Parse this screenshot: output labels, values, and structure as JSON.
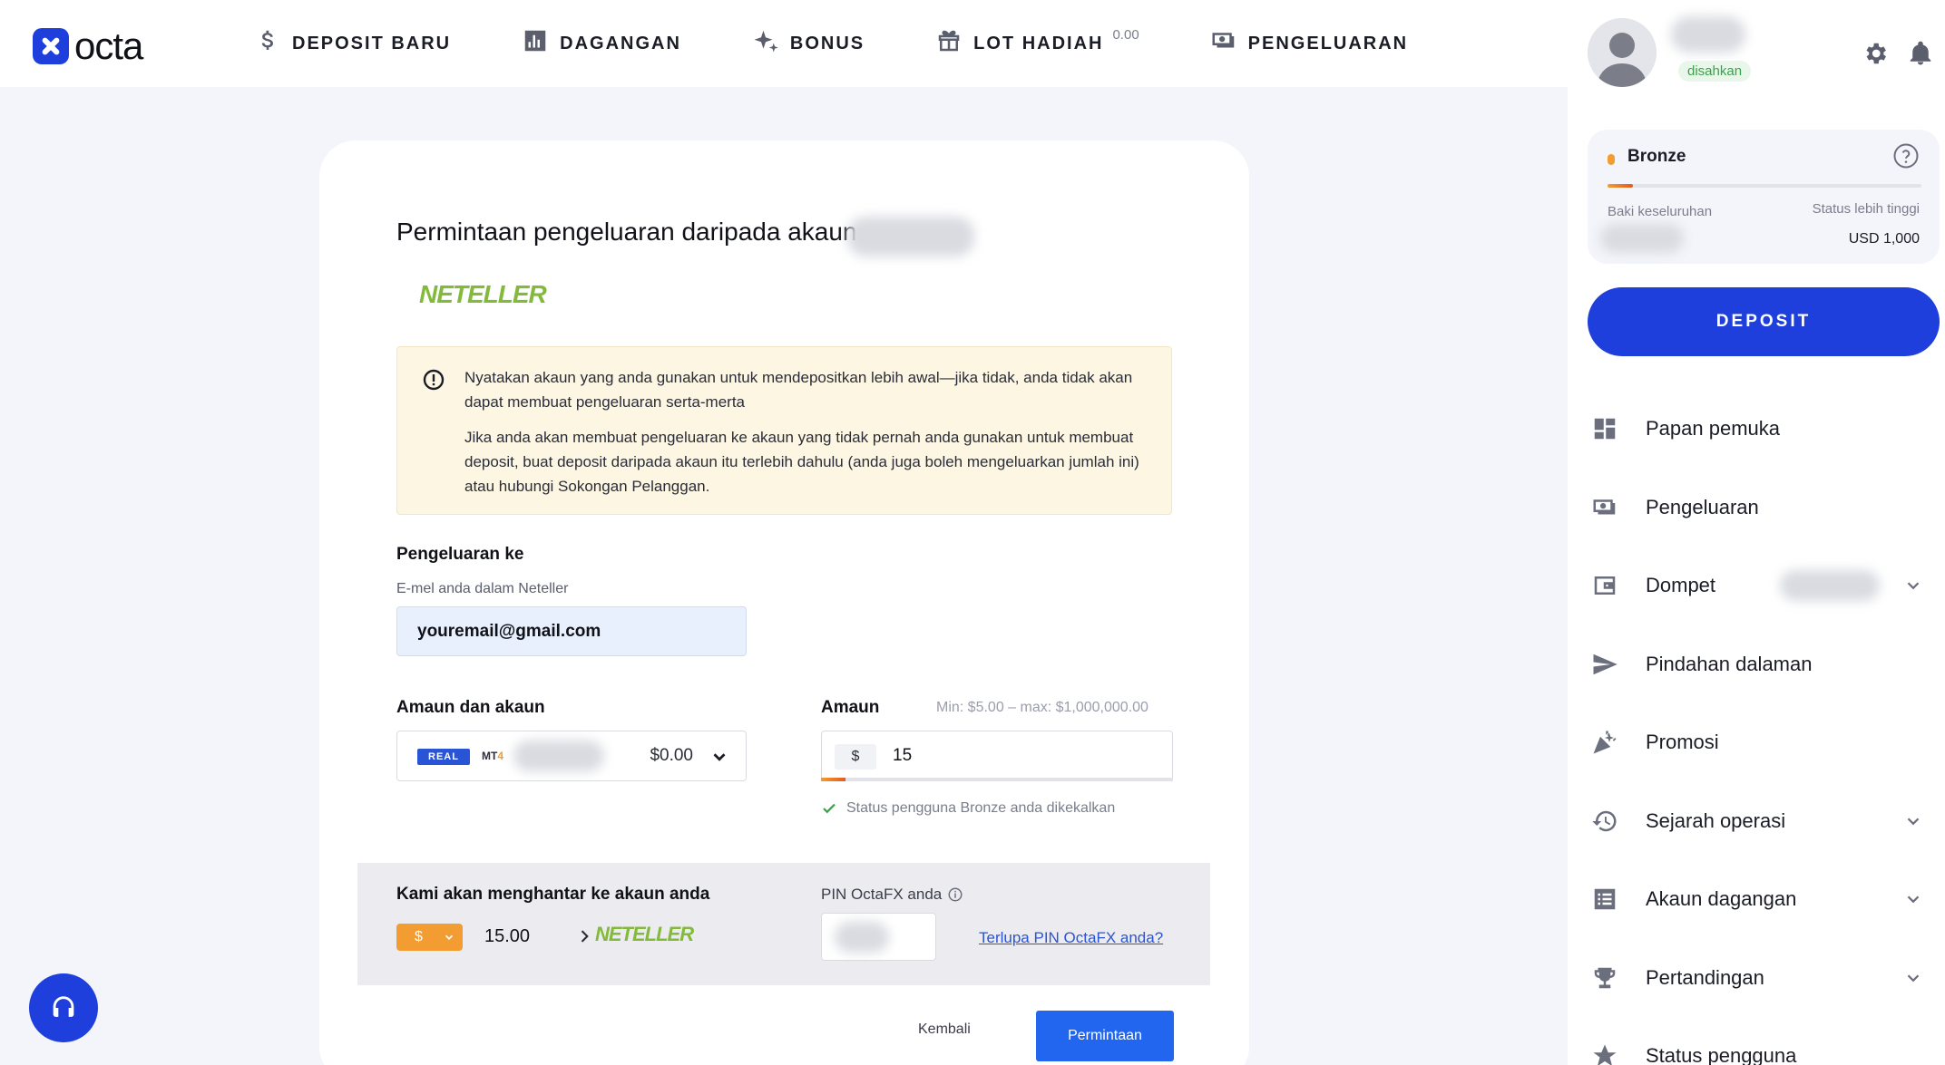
{
  "brand": {
    "name": "octa"
  },
  "nav": [
    {
      "label": "DEPOSIT BARU",
      "icon": "dollar-icon"
    },
    {
      "label": "DAGANGAN",
      "icon": "chart-icon"
    },
    {
      "label": "BONUS",
      "icon": "sparkle-icon"
    },
    {
      "label": "LOT HADIAH",
      "icon": "gift-icon",
      "sup": "0.00"
    },
    {
      "label": "PENGELUARAN",
      "icon": "withdraw-icon"
    }
  ],
  "profile": {
    "verified_label": "disahkan"
  },
  "status_card": {
    "title": "Bronze",
    "left_label": "Baki keseluruhan",
    "right_label": "Status lebih tinggi",
    "right_value": "USD 1,000",
    "progress": 0.08
  },
  "deposit_button": "DEPOSIT",
  "menu": [
    {
      "label": "Papan pemuka",
      "icon": "dashboard-icon",
      "chevron": false
    },
    {
      "label": "Pengeluaran",
      "icon": "withdraw-icon",
      "chevron": false
    },
    {
      "label": "Dompet",
      "icon": "wallet-icon",
      "chevron": true
    },
    {
      "label": "Pindahan dalaman",
      "icon": "send-icon",
      "chevron": false
    },
    {
      "label": "Promosi",
      "icon": "party-icon",
      "chevron": false
    },
    {
      "label": "Sejarah operasi",
      "icon": "history-icon",
      "chevron": true
    },
    {
      "label": "Akaun dagangan",
      "icon": "list-icon",
      "chevron": true
    },
    {
      "label": "Pertandingan",
      "icon": "trophy-icon",
      "chevron": true
    },
    {
      "label": "Status pengguna",
      "icon": "star-icon",
      "chevron": false
    }
  ],
  "form": {
    "title": "Permintaan pengeluaran daripada akaun",
    "method_logo": "NETELLER",
    "warning_p1": "Nyatakan akaun yang anda gunakan untuk mendepositkan lebih awal—jika tidak, anda tidak akan dapat membuat pengeluaran serta-merta",
    "warning_p2": "Jika anda akan membuat pengeluaran ke akaun yang tidak pernah anda gunakan untuk membuat deposit, buat deposit daripada akaun itu terlebih dahulu (anda juga boleh mengeluarkan jumlah ini) atau hubungi Sokongan Pelanggan.",
    "withdraw_to_label": "Pengeluaran ke",
    "email_label": "E-mel anda dalam Neteller",
    "email_value": "youremail@gmail.com",
    "amount_account_label": "Amaun dan akaun",
    "account_badge": "REAL",
    "account_platform": "MT",
    "account_platform_num": "4",
    "account_balance": "$0.00",
    "amount_label": "Amaun",
    "amount_limits": "Min: $5.00 – max: $1,000,000.00",
    "currency_symbol": "$",
    "amount_value": "15",
    "amount_progress": 0.07,
    "status_note": "Status pengguna Bronze anda dikekalkan",
    "summary_title": "Kami akan menghantar ke akaun anda",
    "summary_currency": "$",
    "summary_amount": "15.00",
    "pin_label": "PIN OctaFX anda",
    "forgot_pin": "Terlupa PIN OctaFX anda?",
    "back_label": "Kembali",
    "submit_label": "Permintaan"
  }
}
